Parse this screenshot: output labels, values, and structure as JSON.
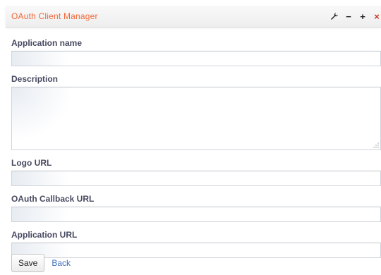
{
  "header": {
    "title": "OAuth Client Manager",
    "controls": {
      "settings_icon": "wrench-icon",
      "minimize_label": "−",
      "maximize_label": "+",
      "close_label": "×"
    }
  },
  "form": {
    "fields": {
      "app_name_label": "Application name",
      "description_label": "Description",
      "logo_url_label": "Logo URL",
      "callback_url_label": "OAuth Callback URL",
      "app_url_label": "Application URL"
    },
    "values": {
      "app_name": "",
      "description": "",
      "logo_url": "",
      "callback_url": "",
      "app_url": ""
    }
  },
  "actions": {
    "save_label": "Save",
    "back_label": "Back"
  },
  "colors": {
    "title": "#f06a3a",
    "label": "#474a60",
    "link": "#3f6fbf"
  }
}
